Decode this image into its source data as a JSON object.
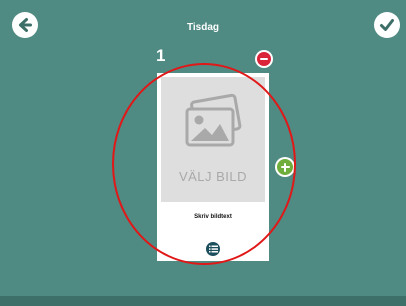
{
  "header": {
    "title": "Tisdag",
    "back_icon": "arrow-left-icon",
    "confirm_icon": "checkmark-icon"
  },
  "card": {
    "number": "1",
    "image_placeholder": "VÄLJ BILD",
    "image_icon": "images-icon",
    "caption_placeholder": "Skriv bildtext",
    "list_icon": "list-icon",
    "remove_icon": "minus-circle-icon"
  },
  "add_icon": "plus-circle-icon",
  "colors": {
    "background": "#4f8a83",
    "bottom_bar": "#3c7069",
    "remove": "#d9243a",
    "add": "#6fae3c",
    "annotation_ring": "#e01818"
  }
}
